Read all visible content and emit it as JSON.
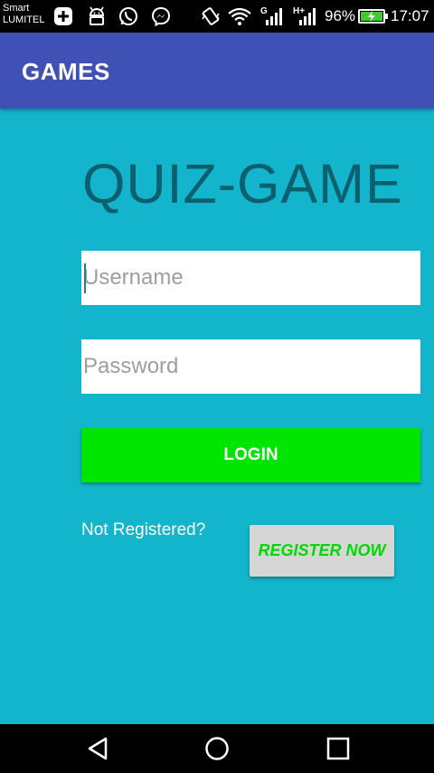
{
  "status_bar": {
    "carrier_line1": "Smart",
    "carrier_line2": "LUMITEL",
    "battery_percent": "96%",
    "time": "17:07",
    "network_g": "G",
    "network_h": "H+",
    "icons": [
      "plus-square-icon",
      "android-icon",
      "whatsapp-icon",
      "messenger-icon",
      "vibrate-icon",
      "wifi-icon",
      "signal-icon",
      "signal-icon",
      "battery-charging-icon"
    ],
    "battery_color": "#43c733"
  },
  "app_bar": {
    "title": "GAMES",
    "color": "#3f51b5"
  },
  "main": {
    "background": "#12b5cb",
    "title": "QUIZ-GAME",
    "username_placeholder": "Username",
    "password_placeholder": "Password",
    "login_label": "LOGIN",
    "not_registered_text": "Not Registered?",
    "register_label": "REGISTER NOW",
    "login_color": "#00e500"
  },
  "nav_bar": {
    "icons": [
      "back-icon",
      "home-icon",
      "recents-icon"
    ]
  }
}
